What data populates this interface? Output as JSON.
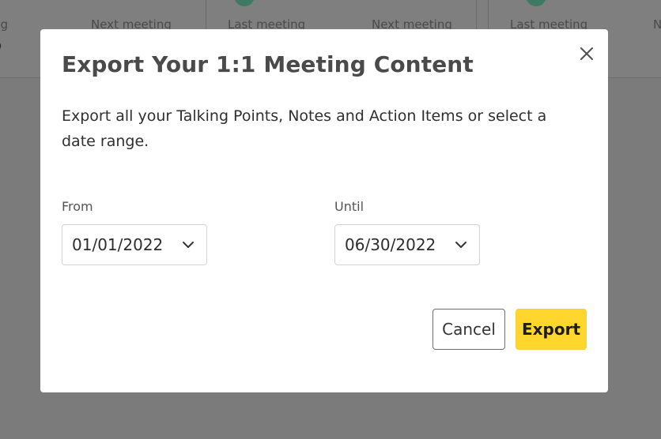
{
  "background": {
    "cards": [
      {
        "label": "ting",
        "value": "go"
      },
      {
        "label": "Next meeting",
        "value": ""
      },
      {
        "label": "Last meeting",
        "value": ""
      },
      {
        "label": "Next meeting",
        "value": ""
      },
      {
        "label": "Last meeting",
        "value": ""
      },
      {
        "label": "N",
        "value": ""
      }
    ]
  },
  "modal": {
    "title": "Export Your 1:1 Meeting Content",
    "description": "Export all your Talking Points, Notes and Action Items or select a date range.",
    "close_icon": "close-icon",
    "from": {
      "label": "From",
      "value": "01/01/2022"
    },
    "until": {
      "label": "Until",
      "value": "06/30/2022"
    },
    "buttons": {
      "cancel": "Cancel",
      "export": "Export"
    }
  },
  "colors": {
    "overlay": "#7b7b7b",
    "modal_bg": "#ffffff",
    "export_bg": "#ffd62e",
    "title_text": "#4a4a4a",
    "bg_accent": "#3e7a61"
  }
}
